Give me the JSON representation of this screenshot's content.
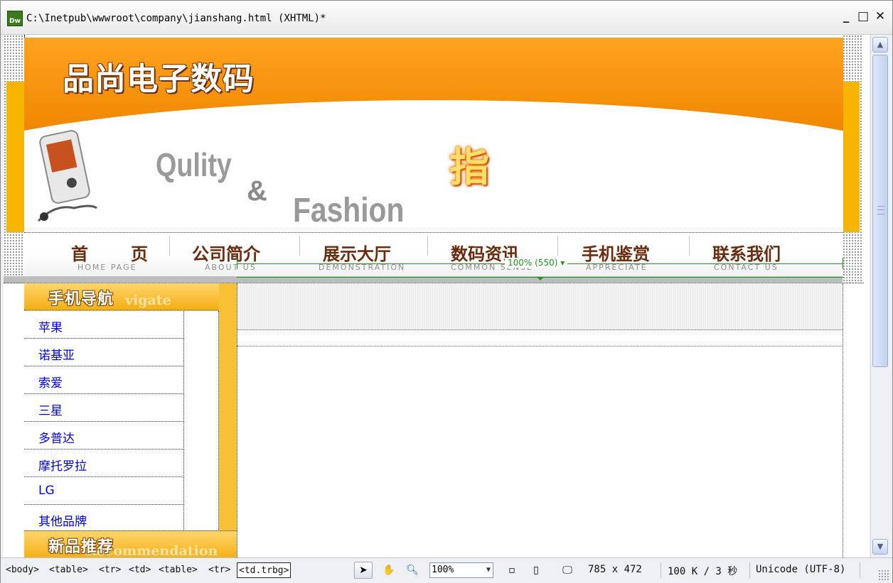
{
  "window": {
    "title": "C:\\Inetpub\\wwwroot\\company\\jianshang.html (XHTML)*",
    "app_icon_label": "Dw",
    "minimize_glyph": "_",
    "maximize_glyph": "□",
    "close_glyph": "✕"
  },
  "banner": {
    "logo_text": "品尚电子数码",
    "slogan_1": "Qulity",
    "slogan_amp": "&",
    "slogan_2": "Fashion",
    "glow_char": "指"
  },
  "nav": {
    "items": [
      {
        "cn": "首　页",
        "en": "HOME PAGE"
      },
      {
        "cn": "公司简介",
        "en": "ABOUT US"
      },
      {
        "cn": "展示大厅",
        "en": "DEMONSTRATION"
      },
      {
        "cn": "数码资讯",
        "en": "COMMON SENSE"
      },
      {
        "cn": "手机鉴赏",
        "en": "APPRECIATE"
      },
      {
        "cn": "联系我们",
        "en": "CONTACT US"
      }
    ]
  },
  "width_indicator": {
    "label": "100% (550)"
  },
  "sidebar": {
    "nav_title": "手机导航",
    "nav_title_en": "vigate",
    "items": [
      "苹果",
      "诺基亚",
      "索爱",
      "三星",
      "多普达",
      "摩托罗拉",
      "LG",
      "其他品牌"
    ],
    "new_title": "新品推荐",
    "new_title_en": "Recommendation"
  },
  "status": {
    "tags": [
      "<body>",
      "<table>",
      "<tr>",
      "<td>",
      "<table>",
      "<tr>",
      "<td.trbg>"
    ],
    "zoom": "100%",
    "size": "785 x 472",
    "download": "100 K / 3 秒",
    "encoding": "Unicode (UTF-8)"
  },
  "colors": {
    "orange": "#f08600",
    "yellow": "#f7b500",
    "nav_text": "#6b2b0c",
    "link": "#0000ee",
    "guide_green": "#1a9a1a"
  }
}
